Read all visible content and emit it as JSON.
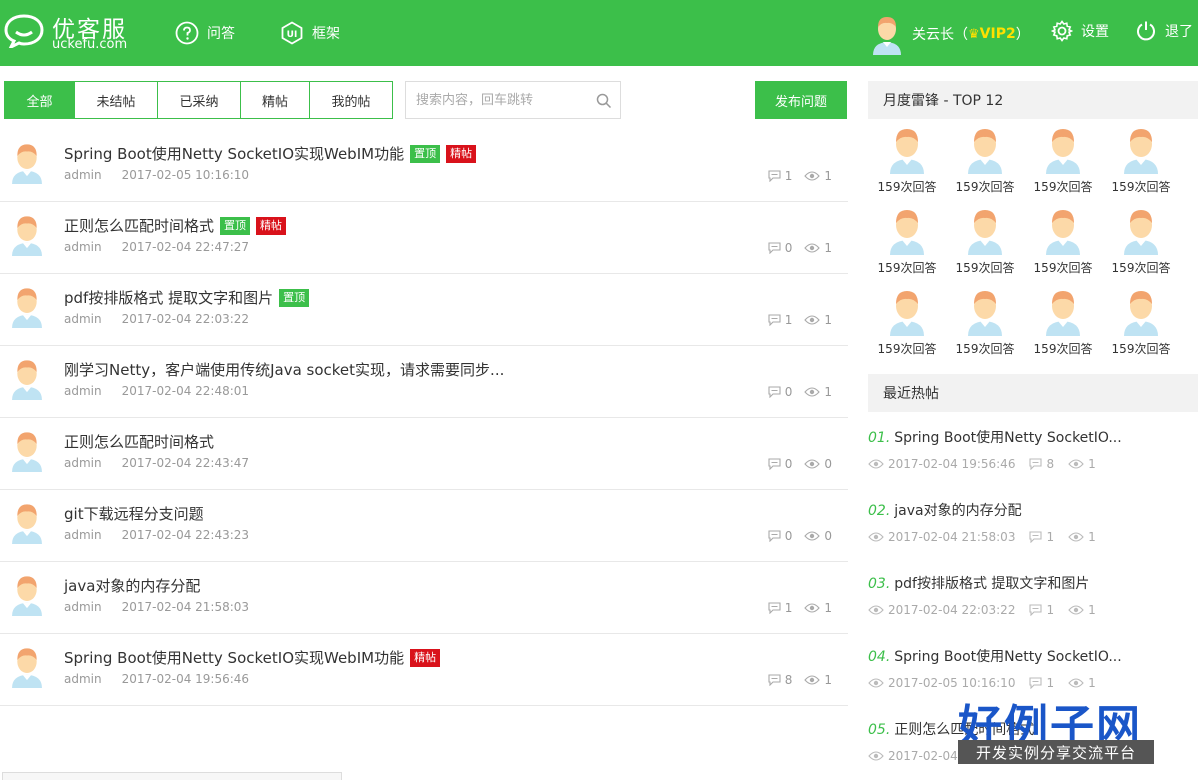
{
  "header": {
    "logo_title": "优客服",
    "logo_sub": "uckefu.com",
    "nav": [
      {
        "label": "问答",
        "icon": "question-icon"
      },
      {
        "label": "框架",
        "icon": "ui-framework-icon"
      }
    ],
    "user_name": "关云长（",
    "user_vip": "VIP2",
    "user_close": "）",
    "settings_label": "设置",
    "logout_label": "退了",
    "bg_color": "#3cbf4a"
  },
  "tabs": [
    {
      "label": "全部",
      "active": true
    },
    {
      "label": "未结帖",
      "active": false
    },
    {
      "label": "已采纳",
      "active": false
    },
    {
      "label": "精帖",
      "active": false
    },
    {
      "label": "我的帖",
      "active": false
    }
  ],
  "search": {
    "placeholder": "搜索内容，回车跳转"
  },
  "publish_label": "发布问题",
  "posts": [
    {
      "title": "Spring Boot使用Netty SocketIO实现WebIM功能",
      "badges": [
        "置顶",
        "精帖"
      ],
      "author": "admin",
      "time": "2017-02-05 10:16:10",
      "comments": "1",
      "views": "1"
    },
    {
      "title": "正则怎么匹配时间格式",
      "badges": [
        "置顶",
        "精帖"
      ],
      "author": "admin",
      "time": "2017-02-04 22:47:27",
      "comments": "0",
      "views": "1"
    },
    {
      "title": "pdf按排版格式 提取文字和图片",
      "badges": [
        "置顶"
      ],
      "author": "admin",
      "time": "2017-02-04 22:03:22",
      "comments": "1",
      "views": "1"
    },
    {
      "title": "刚学习Netty，客户端使用传统Java socket实现，请求需要同步...",
      "badges": [],
      "author": "admin",
      "time": "2017-02-04 22:48:01",
      "comments": "0",
      "views": "1"
    },
    {
      "title": "正则怎么匹配时间格式",
      "badges": [],
      "author": "admin",
      "time": "2017-02-04 22:43:47",
      "comments": "0",
      "views": "0"
    },
    {
      "title": "git下载远程分支问题",
      "badges": [],
      "author": "admin",
      "time": "2017-02-04 22:43:23",
      "comments": "0",
      "views": "0"
    },
    {
      "title": "java对象的内存分配",
      "badges": [],
      "author": "admin",
      "time": "2017-02-04 21:58:03",
      "comments": "1",
      "views": "1"
    },
    {
      "title": "Spring Boot使用Netty SocketIO实现WebIM功能",
      "badges": [
        "精帖"
      ],
      "author": "admin",
      "time": "2017-02-04 19:56:46",
      "comments": "8",
      "views": "1"
    }
  ],
  "sidebar": {
    "top_title": "月度雷锋 - TOP 12",
    "top_users": [
      "159次回答",
      "159次回答",
      "159次回答",
      "159次回答",
      "159次回答",
      "159次回答",
      "159次回答",
      "159次回答",
      "159次回答",
      "159次回答",
      "159次回答",
      "159次回答"
    ],
    "hot_title": "最近热帖",
    "hot_posts": [
      {
        "num": "01.",
        "title": "Spring Boot使用Netty SocketIO...",
        "time": "2017-02-04 19:56:46",
        "comments": "8",
        "views": "1"
      },
      {
        "num": "02.",
        "title": "java对象的内存分配",
        "time": "2017-02-04 21:58:03",
        "comments": "1",
        "views": "1"
      },
      {
        "num": "03.",
        "title": "pdf按排版格式 提取文字和图片",
        "time": "2017-02-04 22:03:22",
        "comments": "1",
        "views": "1"
      },
      {
        "num": "04.",
        "title": "Spring Boot使用Netty SocketIO...",
        "time": "2017-02-05 10:16:10",
        "comments": "1",
        "views": "1"
      },
      {
        "num": "05.",
        "title": "正则怎么匹配时间格式",
        "time": "2017-02-04",
        "comments": "",
        "views": ""
      }
    ]
  },
  "watermark": {
    "big": "好例子网",
    "small": "开发实例分享交流平台"
  }
}
